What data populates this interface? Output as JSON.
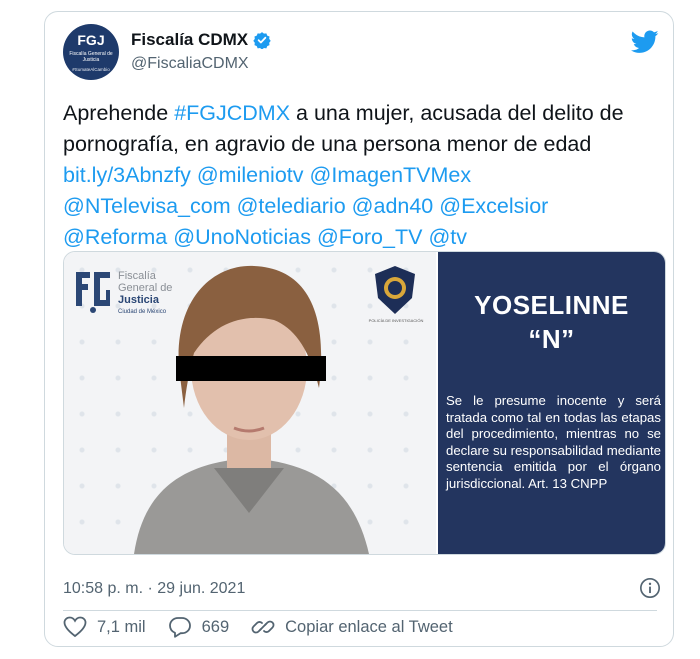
{
  "account": {
    "name": "Fiscalía CDMX",
    "handle": "@FiscaliaCDMX",
    "avatar_label": "Fiscalía General de Justicia",
    "avatar_tag": "#SumateAlCambio"
  },
  "tweet": {
    "text_start": "Aprehende ",
    "hashtag": "#FGJCDMX",
    "text_mid": " a una mujer, acusada del delito de pornografía, en agravio de una persona menor de edad",
    "url": "bit.ly/3Abnzfy",
    "mentions": [
      "@mileniotv",
      "@ImagenTVMex",
      "@NTelevisa_com",
      "@telediario",
      "@adn40",
      "@Excelsior",
      "@Reforma",
      "@UnoNoticias",
      "@Foro_TV",
      "@tv"
    ]
  },
  "media": {
    "fgj_line1": "Fiscalía",
    "fgj_line2": "General de",
    "fgj_line3": "Justicia",
    "fgj_line4": "Ciudad de México",
    "pdi_label": "POLICÍA DE INVESTIGACIÓN",
    "person_name": "YOSELINNE",
    "person_initial": "“N”",
    "disclaimer": "Se le presume inocente y será tratada como tal en todas las etapas del procedimiento, mientras no se declare su responsabilidad mediante sentencia emitida por el órgano jurisdiccional. Art. 13 CNPP"
  },
  "meta": {
    "timestamp": "10:58 p. m. · 29 jun. 2021"
  },
  "actions": {
    "likes": "7,1 mil",
    "replies": "669",
    "copy_link": "Copiar enlace al Tweet"
  },
  "colors": {
    "link": "#1d9bf0",
    "panel": "#23355f",
    "verified": "#1d9bf0"
  }
}
